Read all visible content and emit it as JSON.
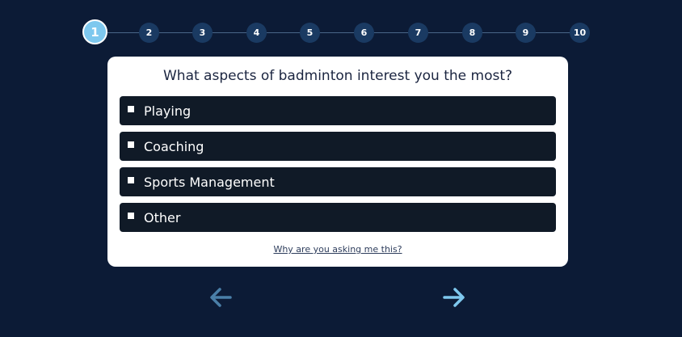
{
  "stepper": {
    "steps": [
      "1",
      "2",
      "3",
      "4",
      "5",
      "6",
      "7",
      "8",
      "9",
      "10"
    ],
    "current": 1
  },
  "card": {
    "question": "What aspects of badminton interest you the most?",
    "options": [
      {
        "label": "Playing",
        "checked": false
      },
      {
        "label": "Coaching",
        "checked": false
      },
      {
        "label": "Sports Management",
        "checked": false
      },
      {
        "label": "Other",
        "checked": false
      }
    ],
    "why_link": "Why are you asking me this?"
  },
  "nav": {
    "back_icon": "arrow-left-icon",
    "next_icon": "arrow-right-icon"
  },
  "colors": {
    "background": "#0c1b36",
    "step_active": "#7ec8ee",
    "step_inactive": "#1a3a62",
    "option_bg": "#101a27",
    "arrow_back": "#4a7fa8",
    "arrow_next": "#7ec8ee"
  }
}
